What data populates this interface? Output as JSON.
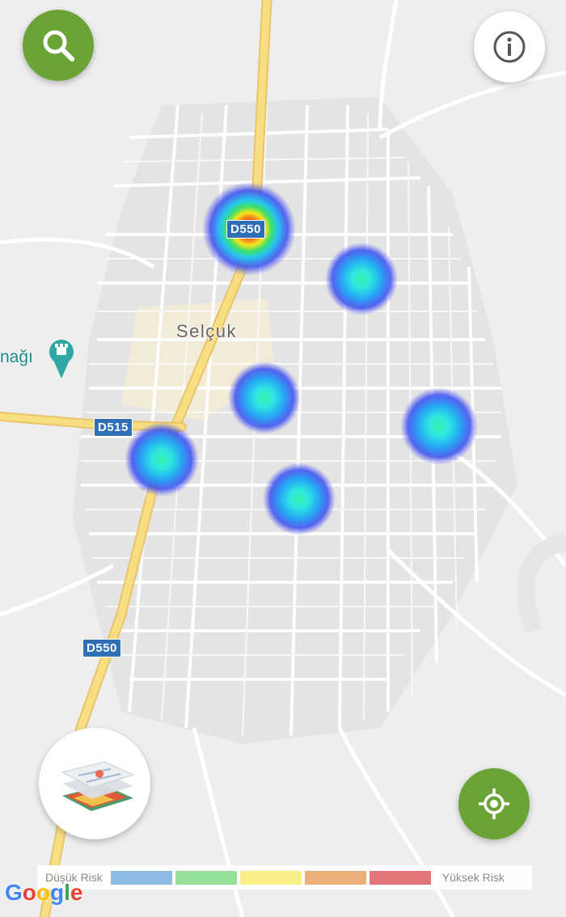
{
  "map": {
    "town_label": "Selçuk",
    "poi_label": "nağı",
    "road_shields": [
      "D550",
      "D515",
      "D550"
    ]
  },
  "legend": {
    "low_label": "Düşük Risk",
    "high_label": "Yüksek Risk",
    "colors": [
      "#8ebbe4",
      "#96e09a",
      "#f7ee87",
      "#eab27a",
      "#e3747a"
    ]
  },
  "attribution": {
    "logo": "Google"
  },
  "controls": {
    "search_icon": "search-icon",
    "info_icon": "info-icon",
    "locate_icon": "my-location-icon",
    "layers_icon": "map-layers-icon"
  },
  "hotspots": [
    {
      "level": "high"
    },
    {
      "level": "low"
    },
    {
      "level": "low"
    },
    {
      "level": "low"
    },
    {
      "level": "low"
    },
    {
      "level": "low"
    }
  ]
}
